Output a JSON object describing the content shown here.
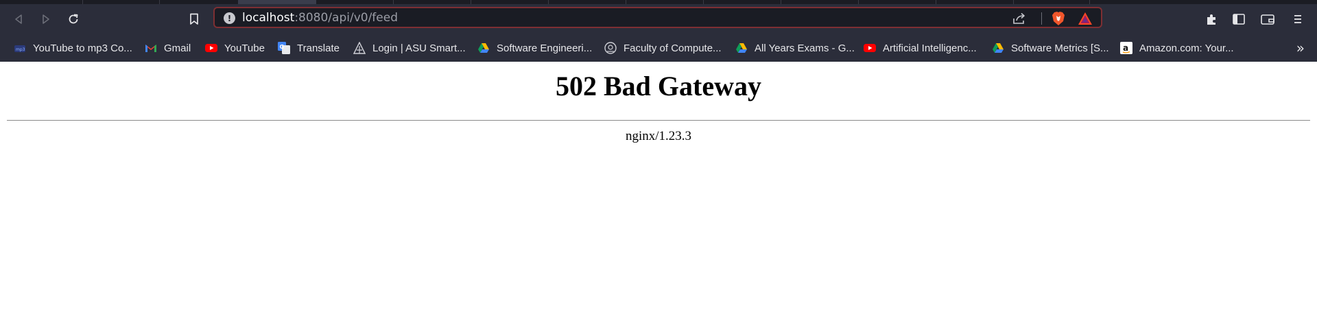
{
  "browser": {
    "address_bar": {
      "host": "localhost",
      "path": ":8080/api/v0/feed"
    },
    "toolbar_icons": [
      "back-icon",
      "forward-icon",
      "reload-icon",
      "bookmark-icon",
      "share-icon",
      "brave-shields-icon",
      "brave-rewards-icon",
      "extensions-icon",
      "sidebar-icon",
      "wallet-icon",
      "menu-icon"
    ],
    "bookmarks": [
      {
        "label": "YouTube to mp3 Co...",
        "icon": "ytmp3-icon"
      },
      {
        "label": "Gmail",
        "icon": "gmail-icon"
      },
      {
        "label": "YouTube",
        "icon": "youtube-icon"
      },
      {
        "label": "Translate",
        "icon": "translate-icon"
      },
      {
        "label": "Login | ASU Smart...",
        "icon": "asu-icon"
      },
      {
        "label": "Software Engineeri...",
        "icon": "drive-icon"
      },
      {
        "label": "Faculty of Compute...",
        "icon": "faculty-icon"
      },
      {
        "label": "All Years Exams - G...",
        "icon": "drive-icon"
      },
      {
        "label": "Artificial Intelligenc...",
        "icon": "youtube-icon"
      },
      {
        "label": "Software Metrics [S...",
        "icon": "drive-icon"
      },
      {
        "label": "Amazon.com: Your...",
        "icon": "amazon-icon"
      }
    ],
    "bookmarks_overflow": "»"
  },
  "page": {
    "title": "502 Bad Gateway",
    "server": "nginx/1.23.3"
  },
  "colors": {
    "chrome_bg": "#2b2d3a",
    "urlbar_bg": "#1a1c24",
    "urlbar_border": "#7e2f33",
    "page_bg": "#ffffff"
  }
}
